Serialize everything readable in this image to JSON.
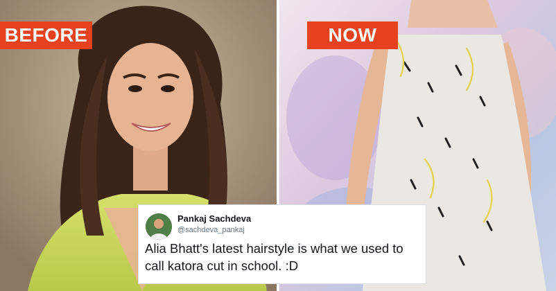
{
  "labels": {
    "before": "BEFORE",
    "now": "NOW"
  },
  "tweet": {
    "author_name": "Pankaj Sachdeva",
    "author_handle": "@sachdeva_pankaj",
    "text": "Alia Bhatt's latest hairstyle is what we used to call katora cut in school. :D"
  },
  "colors": {
    "label_background": "#e8411f",
    "label_text": "#ffffff",
    "blouse": "#c8d95a",
    "hair": "#3a2418",
    "skin": "#e7b493",
    "dress": "#ebe8e4"
  },
  "icons": [
    "avatar"
  ]
}
